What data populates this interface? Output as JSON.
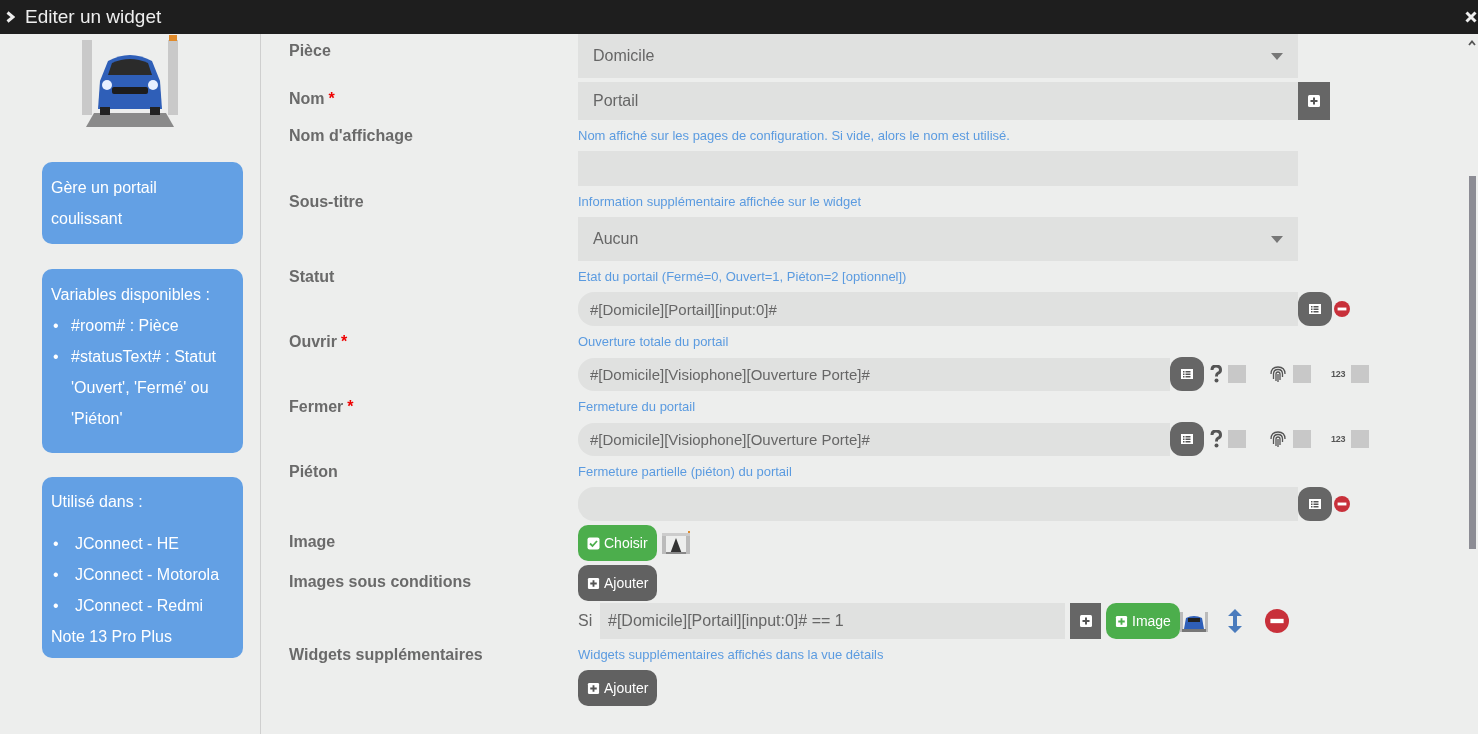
{
  "window": {
    "title": "Editer un widget"
  },
  "sidebar": {
    "description": "Gère un portail coulissant",
    "variables": {
      "title": "Variables disponibles :",
      "bullet": "•",
      "items": [
        "#room# : Pièce",
        "#statusText# : Statut 'Ouvert', 'Fermé' ou 'Piéton'"
      ]
    },
    "used_in": {
      "title": "Utilisé dans :",
      "bullet": "•",
      "items": [
        "JConnect - HE",
        "JConnect - Motorola",
        "JConnect - Redmi"
      ],
      "trailing_text": "Note 13 Pro Plus"
    }
  },
  "form": {
    "fields": [
      {
        "label": "Pièce",
        "kind": "select",
        "value": "Domicile"
      },
      {
        "label": "Nom",
        "required_mark": "*",
        "kind": "text-add",
        "value": "Portail"
      },
      {
        "label": "Nom d'affichage",
        "hint": "Nom affiché sur les pages de configuration. Si vide, alors le nom est utilisé.",
        "kind": "text"
      },
      {
        "label": "Sous-titre",
        "hint": "Information supplémentaire affichée sur le widget",
        "kind": "select",
        "value": "Aucun"
      },
      {
        "label": "Statut",
        "hint": "Etat du portail (Fermé=0, Ouvert=1, Piéton=2 [optionnel])",
        "kind": "binding",
        "value": "#[Domicile][Portail][input:0]#"
      },
      {
        "label": "Ouvrir",
        "required_mark": "*",
        "hint": "Ouverture totale du portail",
        "kind": "action",
        "value": "#[Domicile][Visiophone][Ouverture Porte]#",
        "options": [
          {
            "kind": "help",
            "checked": false
          },
          {
            "kind": "fingerprint",
            "checked": false
          },
          {
            "kind": "numeric",
            "text": "123",
            "checked": false
          }
        ]
      },
      {
        "label": "Fermer",
        "required_mark": "*",
        "hint": "Fermeture du portail",
        "kind": "action",
        "value": "#[Domicile][Visiophone][Ouverture Porte]#",
        "options": [
          {
            "kind": "help",
            "checked": false
          },
          {
            "kind": "fingerprint",
            "checked": false
          },
          {
            "kind": "numeric",
            "text": "123",
            "checked": false
          }
        ]
      },
      {
        "label": "Piéton",
        "hint": "Fermeture partielle (piéton) du portail",
        "kind": "binding"
      },
      {
        "label": "Image",
        "kind": "image-picker",
        "button": "Choisir"
      },
      {
        "label": "Images sous conditions",
        "kind": "conditions",
        "button": "Ajouter",
        "conditions": [
          {
            "prefix": "Si",
            "expression": "#[Domicile][Portail][input:0]# == 1",
            "image_button": "Image"
          }
        ]
      },
      {
        "label": "Widgets supplémentaires",
        "hint": "Widgets supplémentaires affichés dans la vue détails",
        "kind": "add",
        "button": "Ajouter"
      }
    ]
  }
}
